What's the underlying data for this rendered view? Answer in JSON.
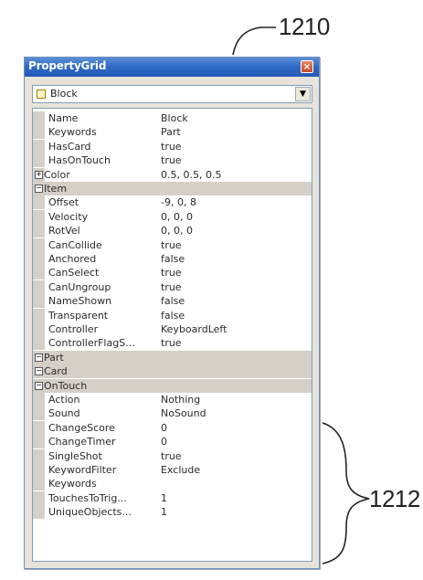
{
  "annotations": {
    "top_label": "1210",
    "side_label": "1212"
  },
  "window": {
    "title": "PropertyGrid",
    "close_glyph": "×",
    "selected_object": "Block",
    "dropdown_glyph": "▼"
  },
  "rows": [
    {
      "kind": "prop",
      "name": "Name",
      "value": "Block"
    },
    {
      "kind": "prop",
      "name": "Keywords",
      "value": "Part"
    },
    {
      "kind": "prop",
      "name": "HasCard",
      "value": "true"
    },
    {
      "kind": "prop",
      "name": "HasOnTouch",
      "value": "true"
    },
    {
      "kind": "expandable",
      "name": "Color",
      "value": "0.5, 0.5, 0.5",
      "toggle": "+"
    },
    {
      "kind": "cat",
      "name": "Item",
      "toggle": "−"
    },
    {
      "kind": "prop",
      "name": "Offset",
      "value": "-9, 0, 8"
    },
    {
      "kind": "prop",
      "name": "Velocity",
      "value": "0, 0, 0"
    },
    {
      "kind": "prop",
      "name": "RotVel",
      "value": "0, 0, 0"
    },
    {
      "kind": "prop",
      "name": "CanCollide",
      "value": "true"
    },
    {
      "kind": "prop",
      "name": "Anchored",
      "value": "false"
    },
    {
      "kind": "prop",
      "name": "CanSelect",
      "value": "true"
    },
    {
      "kind": "prop",
      "name": "CanUngroup",
      "value": "true"
    },
    {
      "kind": "prop",
      "name": "NameShown",
      "value": "false"
    },
    {
      "kind": "prop",
      "name": "Transparent",
      "value": "false"
    },
    {
      "kind": "prop",
      "name": "Controller",
      "value": "KeyboardLeft"
    },
    {
      "kind": "prop",
      "name": "ControllerFlagS...",
      "value": "true"
    },
    {
      "kind": "cat",
      "name": "Part",
      "toggle": "−"
    },
    {
      "kind": "cat",
      "name": "Card",
      "toggle": "−"
    },
    {
      "kind": "cat",
      "name": "OnTouch",
      "toggle": "−"
    },
    {
      "kind": "prop",
      "name": "Action",
      "value": "Nothing"
    },
    {
      "kind": "prop",
      "name": "Sound",
      "value": "NoSound"
    },
    {
      "kind": "prop",
      "name": "ChangeScore",
      "value": "0"
    },
    {
      "kind": "prop",
      "name": "ChangeTimer",
      "value": "0"
    },
    {
      "kind": "prop",
      "name": "SingleShot",
      "value": "true"
    },
    {
      "kind": "prop",
      "name": "KeywordFilter",
      "value": "Exclude"
    },
    {
      "kind": "prop",
      "name": "Keywords",
      "value": ""
    },
    {
      "kind": "prop",
      "name": "TouchesToTrig...",
      "value": "1"
    },
    {
      "kind": "prop",
      "name": "UniqueObjects...",
      "value": "1"
    }
  ]
}
